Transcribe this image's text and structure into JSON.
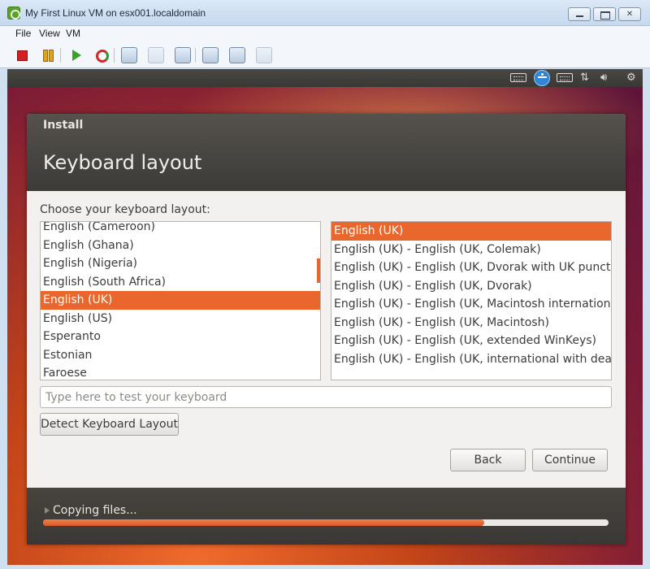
{
  "window": {
    "title": "My First Linux VM on esx001.localdomain"
  },
  "menu": {
    "items": [
      "File",
      "View",
      "VM"
    ]
  },
  "toolbar": {
    "icons": [
      "stop-icon",
      "pause-icon",
      "play-icon",
      "reset-icon",
      "snapshot-icon",
      "revert-snapshot-icon",
      "snapshot-manager-icon",
      "edit-settings-icon",
      "console-icon",
      "connect-device-icon"
    ]
  },
  "indicator_bar": {
    "icons": [
      "keyboard-icon",
      "accessibility-icon",
      "keyboard-layout-icon",
      "network-icon",
      "volume-icon",
      "settings-gear-icon"
    ]
  },
  "installer": {
    "window_label": "Install",
    "title": "Keyboard layout",
    "choose_label": "Choose your keyboard layout:",
    "layouts": [
      "English (Cameroon)",
      "English (Ghana)",
      "English (Nigeria)",
      "English (South Africa)",
      "English (UK)",
      "English (US)",
      "Esperanto",
      "Estonian",
      "Faroese"
    ],
    "selected_layout": "English (UK)",
    "variants": [
      "English (UK)",
      "English (UK) - English (UK, Colemak)",
      "English (UK) - English (UK, Dvorak with UK punctuatio",
      "English (UK) - English (UK, Dvorak)",
      "English (UK) - English (UK, Macintosh international)",
      "English (UK) - English (UK, Macintosh)",
      "English (UK) - English (UK, extended WinKeys)",
      "English (UK) - English (UK, international with dead key"
    ],
    "selected_variant": "English (UK)",
    "test_placeholder": "Type here to test your keyboard",
    "detect_button": "Detect Keyboard Layout",
    "back_button": "Back",
    "continue_button": "Continue",
    "progress_label": "Copying files...",
    "progress_fraction": 0.78
  },
  "colors": {
    "accent": "#e9662c",
    "header_dark": "#3c3b37"
  }
}
